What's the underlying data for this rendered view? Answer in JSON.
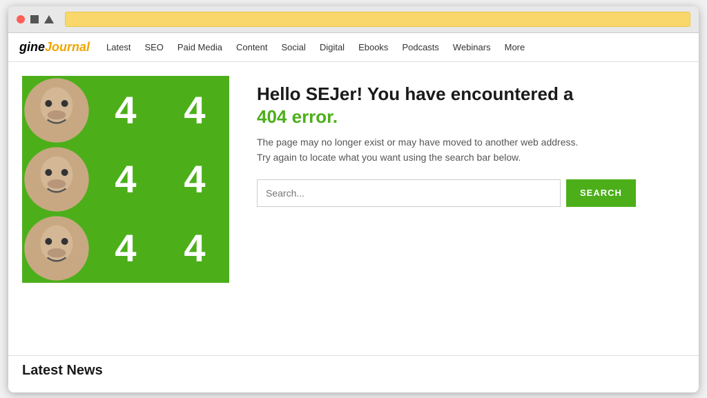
{
  "browser": {
    "shapes": [
      "circle-red",
      "square",
      "triangle"
    ],
    "address_bar_color": "#f9d76b"
  },
  "nav": {
    "logo_engine": "gine",
    "logo_journal": "Journal",
    "items": [
      {
        "label": "Latest"
      },
      {
        "label": "SEO"
      },
      {
        "label": "Paid Media"
      },
      {
        "label": "Content"
      },
      {
        "label": "Social"
      },
      {
        "label": "Digital"
      },
      {
        "label": "Ebooks"
      },
      {
        "label": "Podcasts"
      },
      {
        "label": "Webinars"
      },
      {
        "label": "More"
      }
    ]
  },
  "error_page": {
    "title_line1": "Hello SEJer! You have encountered a",
    "title_line2": "404 error.",
    "description": "The page may no longer exist or may have moved to another web address. Try again to locate what you want using the search bar below.",
    "search_placeholder": "Search...",
    "search_button_label": "SEARCH"
  },
  "latest_news": {
    "title": "Latest News"
  },
  "colors": {
    "green": "#4caf1a",
    "gold": "#f0a500"
  }
}
